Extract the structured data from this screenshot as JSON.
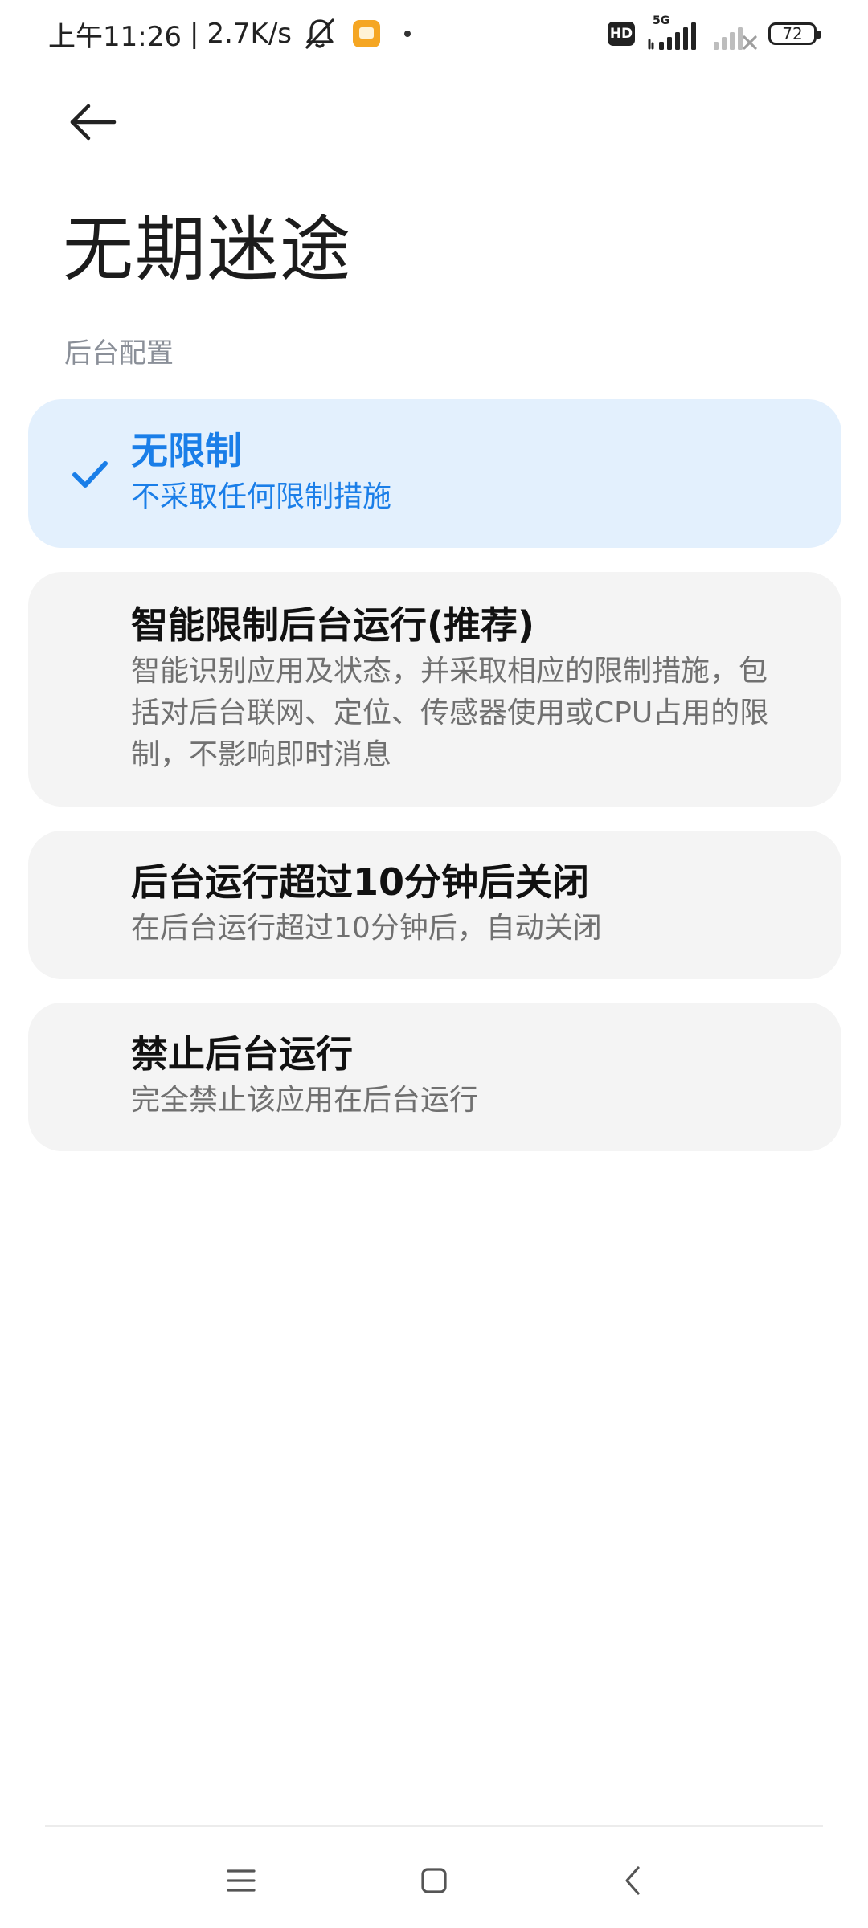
{
  "status_bar": {
    "time": "上午11:26",
    "separator": "|",
    "net_speed": "2.7K/s",
    "hd_label": "HD",
    "network_type": "5G",
    "battery_level": "72"
  },
  "header": {
    "title": "无期迷途"
  },
  "section": {
    "label": "后台配置"
  },
  "options": [
    {
      "title": "无限制",
      "description": "不采取任何限制措施",
      "selected": true
    },
    {
      "title": "智能限制后台运行(推荐)",
      "description": "智能识别应用及状态，并采取相应的限制措施，包括对后台联网、定位、传感器使用或CPU占用的限制，不影响即时消息",
      "selected": false
    },
    {
      "title": "后台运行超过10分钟后关闭",
      "description": "在后台运行超过10分钟后，自动关闭",
      "selected": false
    },
    {
      "title": "禁止后台运行",
      "description": "完全禁止该应用在后台运行",
      "selected": false
    }
  ],
  "colors": {
    "accent": "#1a7ee8",
    "selected_card_bg": "#e3f0fd",
    "card_bg": "#f4f4f4",
    "section_label": "#8a8f98"
  },
  "icons": {
    "back": "arrow-left-icon",
    "check": "check-icon",
    "nav_menu": "menu-icon",
    "nav_home": "home-icon",
    "nav_back": "chevron-left-icon"
  }
}
